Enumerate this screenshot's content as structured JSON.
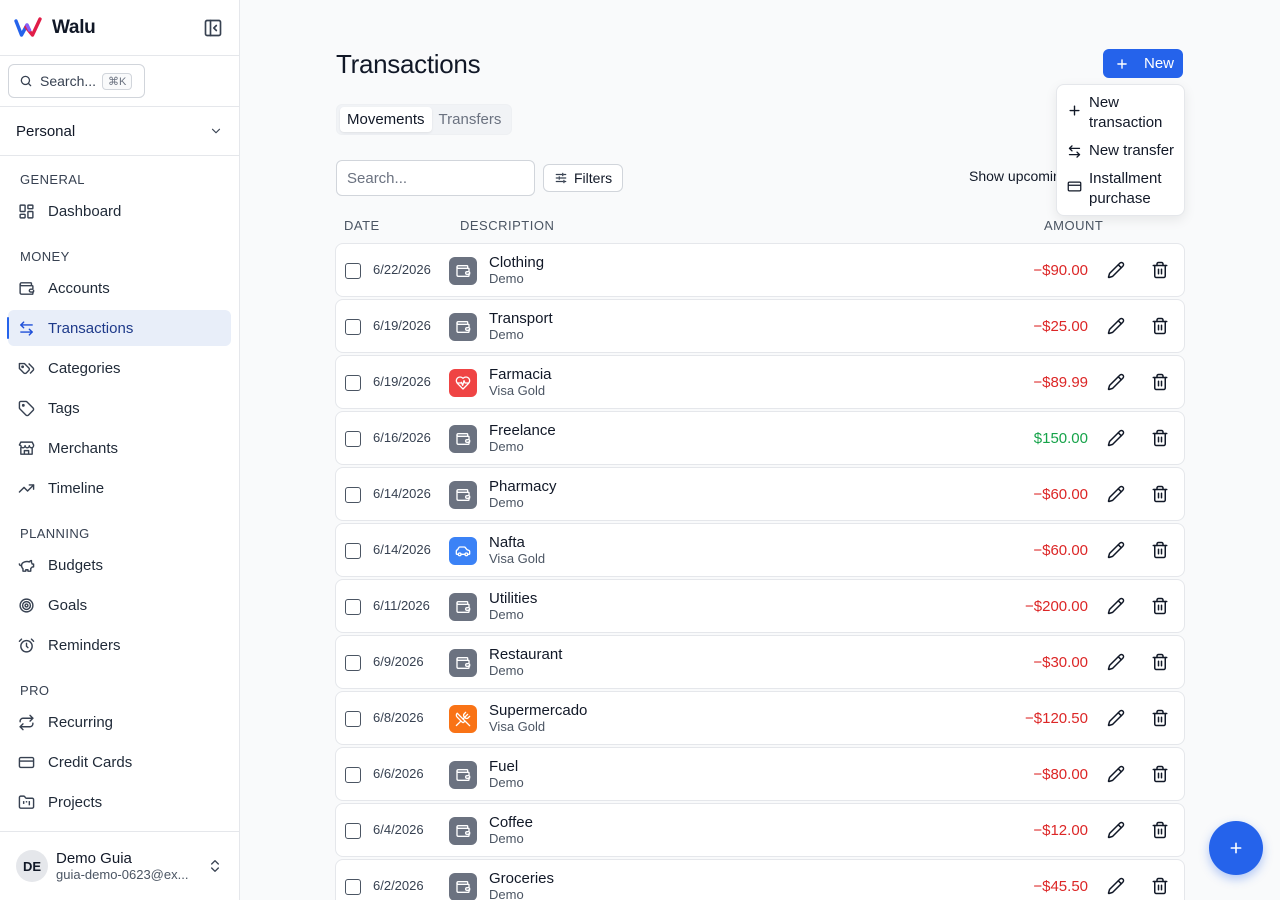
{
  "brand": {
    "name": "Walu"
  },
  "sidebar": {
    "search_label": "Search...",
    "search_shortcut": "⌘K",
    "workspace": "Personal",
    "sections": [
      {
        "title": "General",
        "items": [
          {
            "label": "Dashboard",
            "icon": "dashboard-icon"
          }
        ]
      },
      {
        "title": "Money",
        "items": [
          {
            "label": "Accounts",
            "icon": "wallet-icon"
          },
          {
            "label": "Transactions",
            "icon": "arrows-left-right-icon",
            "active": true
          },
          {
            "label": "Categories",
            "icon": "tag-icon"
          },
          {
            "label": "Tags",
            "icon": "tag-icon"
          },
          {
            "label": "Merchants",
            "icon": "store-icon"
          },
          {
            "label": "Timeline",
            "icon": "trending-up-icon"
          }
        ]
      },
      {
        "title": "Planning",
        "items": [
          {
            "label": "Budgets",
            "icon": "piggy-bank-icon"
          },
          {
            "label": "Goals",
            "icon": "target-icon"
          },
          {
            "label": "Reminders",
            "icon": "alarm-clock-icon"
          }
        ]
      },
      {
        "title": "Pro",
        "items": [
          {
            "label": "Recurring",
            "icon": "repeat-icon"
          },
          {
            "label": "Credit Cards",
            "icon": "credit-card-icon"
          },
          {
            "label": "Projects",
            "icon": "folder-kanban-icon"
          }
        ]
      }
    ],
    "user": {
      "initials": "DE",
      "name": "Demo Guia",
      "email": "guia-demo-0623@ex..."
    }
  },
  "main": {
    "title": "Transactions",
    "new_label": "New",
    "tabs": [
      {
        "label": "Movements",
        "active": true
      },
      {
        "label": "Transfers",
        "active": false
      }
    ],
    "search_placeholder": "Search...",
    "filters_label": "Filters",
    "upcoming_label": "Show upcomin",
    "columns": {
      "date": "Date",
      "description": "Description",
      "amount": "Amount"
    },
    "rows": [
      {
        "date": "6/22/2026",
        "name": "Clothing",
        "account": "Demo",
        "amount": "−$90.00",
        "positive": false,
        "icon": "wallet-icon",
        "color": "#6b7280"
      },
      {
        "date": "6/19/2026",
        "name": "Transport",
        "account": "Demo",
        "amount": "−$25.00",
        "positive": false,
        "icon": "wallet-icon",
        "color": "#6b7280"
      },
      {
        "date": "6/19/2026",
        "name": "Farmacia",
        "account": "Visa Gold",
        "amount": "−$89.99",
        "positive": false,
        "icon": "heart-pulse-icon",
        "color": "#ef4444"
      },
      {
        "date": "6/16/2026",
        "name": "Freelance",
        "account": "Demo",
        "amount": "$150.00",
        "positive": true,
        "icon": "wallet-icon",
        "color": "#6b7280"
      },
      {
        "date": "6/14/2026",
        "name": "Pharmacy",
        "account": "Demo",
        "amount": "−$60.00",
        "positive": false,
        "icon": "wallet-icon",
        "color": "#6b7280"
      },
      {
        "date": "6/14/2026",
        "name": "Nafta",
        "account": "Visa Gold",
        "amount": "−$60.00",
        "positive": false,
        "icon": "car-icon",
        "color": "#3b82f6"
      },
      {
        "date": "6/11/2026",
        "name": "Utilities",
        "account": "Demo",
        "amount": "−$200.00",
        "positive": false,
        "icon": "wallet-icon",
        "color": "#6b7280"
      },
      {
        "date": "6/9/2026",
        "name": "Restaurant",
        "account": "Demo",
        "amount": "−$30.00",
        "positive": false,
        "icon": "wallet-icon",
        "color": "#6b7280"
      },
      {
        "date": "6/8/2026",
        "name": "Supermercado",
        "account": "Visa Gold",
        "amount": "−$120.50",
        "positive": false,
        "icon": "utensils-icon",
        "color": "#f97316"
      },
      {
        "date": "6/6/2026",
        "name": "Fuel",
        "account": "Demo",
        "amount": "−$80.00",
        "positive": false,
        "icon": "wallet-icon",
        "color": "#6b7280"
      },
      {
        "date": "6/4/2026",
        "name": "Coffee",
        "account": "Demo",
        "amount": "−$12.00",
        "positive": false,
        "icon": "wallet-icon",
        "color": "#6b7280"
      },
      {
        "date": "6/2/2026",
        "name": "Groceries",
        "account": "Demo",
        "amount": "−$45.50",
        "positive": false,
        "icon": "wallet-icon",
        "color": "#6b7280"
      }
    ]
  },
  "new_menu": {
    "items": [
      {
        "line1": "New",
        "line2": "transaction",
        "icon": "plus-icon"
      },
      {
        "line1": "New transfer",
        "line2": "",
        "icon": "arrows-left-right-icon"
      },
      {
        "line1": "Installment",
        "line2": "purchase",
        "icon": "credit-card-icon"
      }
    ]
  },
  "colors": {
    "accent": "#2563eb",
    "negative": "#dc2626",
    "positive": "#16a34a"
  }
}
